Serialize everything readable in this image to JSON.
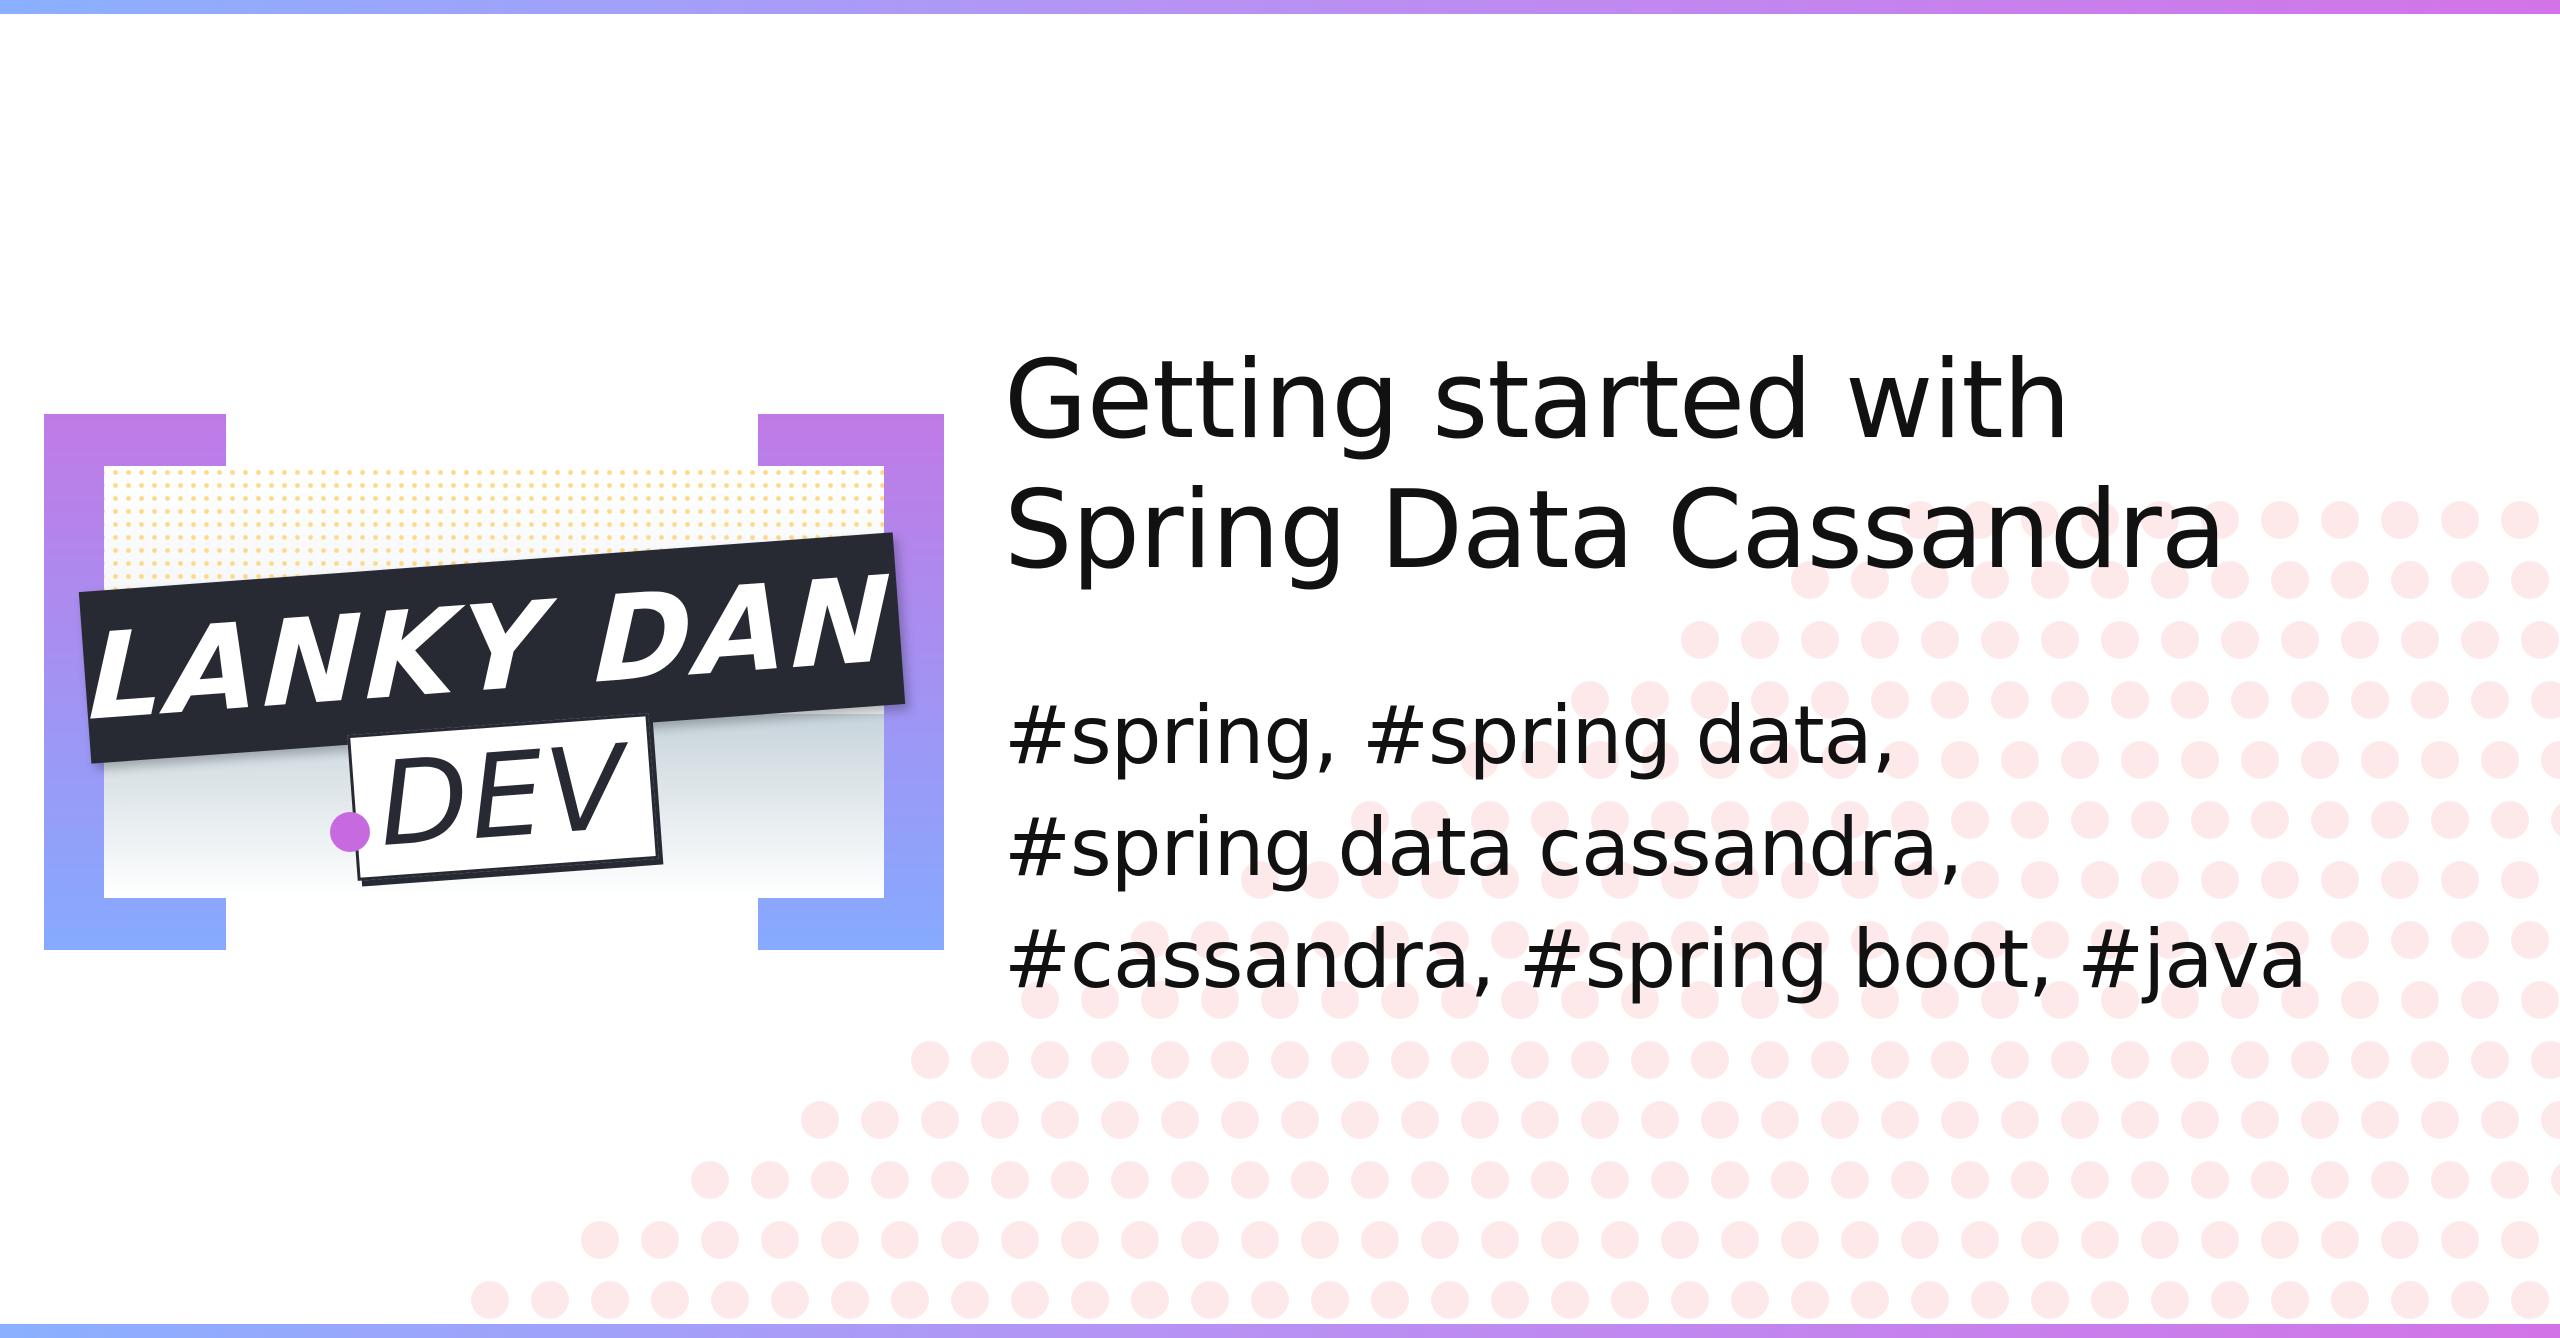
{
  "brand": {
    "logo_line1": "LANKY DAN",
    "logo_line2": "DEV",
    "colors": {
      "bracket_top": "#c07ae6",
      "bracket_bottom": "#86aaff",
      "banner": "#272a33",
      "dot_accent": "#c76ae0",
      "dot_pattern": "#fde9e9",
      "header_bar_start": "#8ab0ff",
      "header_bar_end": "#d274e8"
    }
  },
  "article": {
    "title_line1": "Getting started with",
    "title_line2": "Spring Data Cassandra",
    "tags_line1": "#spring, #spring data,",
    "tags_line2": "#spring data cassandra,",
    "tags_line3": "#cassandra, #spring boot, #java"
  }
}
